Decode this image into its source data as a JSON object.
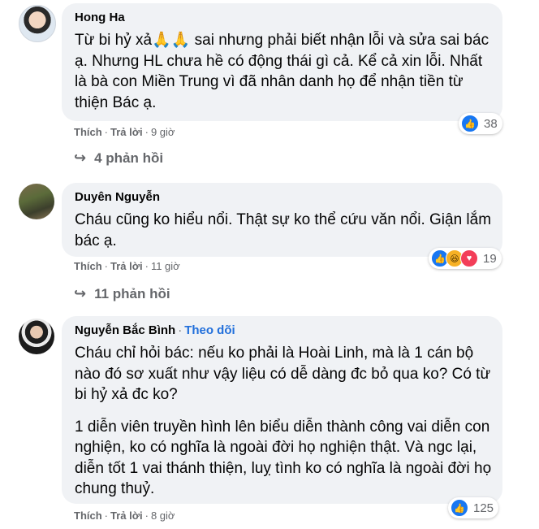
{
  "comments": [
    {
      "author": "Hong Ha",
      "text": [
        "Từ bi hỷ xả🙏🙏 sai nhưng phải biết nhận lỗi và sửa sai bác ạ. Nhưng HL chưa hề có động thái gì cả. Kể cả xin lỗi. Nhất là bà con Miền Trung vì đã nhân danh họ để nhận tiền từ thiện Bác ạ."
      ],
      "like": "Thích",
      "reply": "Trả lời",
      "time": "9 giờ",
      "reaction_count": "38",
      "reactions": [
        "like-icon"
      ],
      "replies": "4 phản hồi"
    },
    {
      "author": "Duyên Nguyễn",
      "text": [
        "Cháu cũng ko hiểu nổi. Thật sự ko thể cứu văn nổi. Giận lắm bác ạ."
      ],
      "like": "Thích",
      "reply": "Trả lời",
      "time": "11 giờ",
      "reaction_count": "19",
      "reactions": [
        "like-icon",
        "haha-icon",
        "love-icon"
      ],
      "replies": "11 phản hồi"
    },
    {
      "author": "Nguyễn Bắc Bình",
      "follow": "Theo dõi",
      "text": [
        "Cháu chỉ hỏi bác: nếu ko phải là Hoài Linh, mà là 1 cán bộ nào đó sơ xuất như vậy liệu có dễ dàng đc bỏ qua ko? Có từ bi hỷ xả đc ko?",
        "1 diễn viên truyền hình lên biểu diễn thành công vai diễn con nghiện, ko có nghĩa là ngoài đời họ nghiện thật. Và ngc lại, diễn tốt 1 vai thánh thiện, luỵ tình ko có nghĩa là ngoài đời họ chung thuỷ."
      ],
      "like": "Thích",
      "reply": "Trả lời",
      "time": "8 giờ",
      "reaction_count": "125",
      "reactions": [
        "like-icon"
      ]
    }
  ],
  "colors": {
    "bubble": "#f0f2f5",
    "meta": "#65676b",
    "link": "#216fdb",
    "like": "#1877f2"
  }
}
